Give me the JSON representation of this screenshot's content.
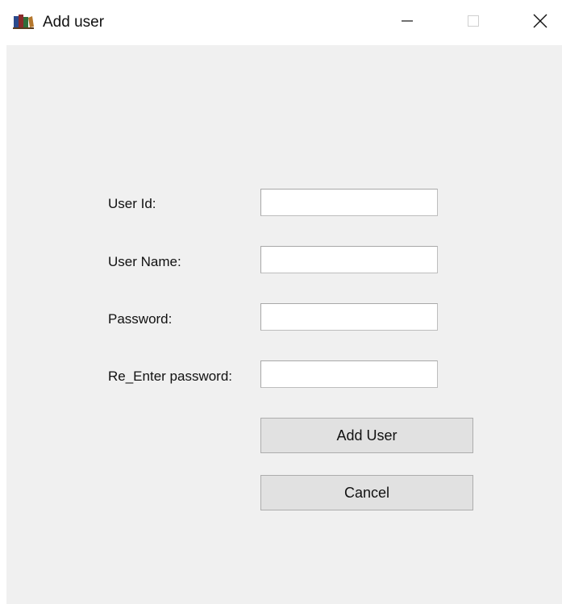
{
  "window": {
    "title": "Add user",
    "icon": "books-icon",
    "controls": {
      "minimize": "minimize-icon",
      "maximize": "maximize-icon",
      "close": "close-icon"
    }
  },
  "form": {
    "user_id": {
      "label": "User Id:",
      "value": ""
    },
    "user_name": {
      "label": "User Name:",
      "value": ""
    },
    "password": {
      "label": "Password:",
      "value": ""
    },
    "re_enter_password": {
      "label": "Re_Enter password:",
      "value": ""
    }
  },
  "buttons": {
    "add_user": "Add User",
    "cancel": "Cancel"
  },
  "colors": {
    "client_background": "#f0f0f0",
    "titlebar_background": "#ffffff",
    "button_face": "#e1e1e1"
  }
}
